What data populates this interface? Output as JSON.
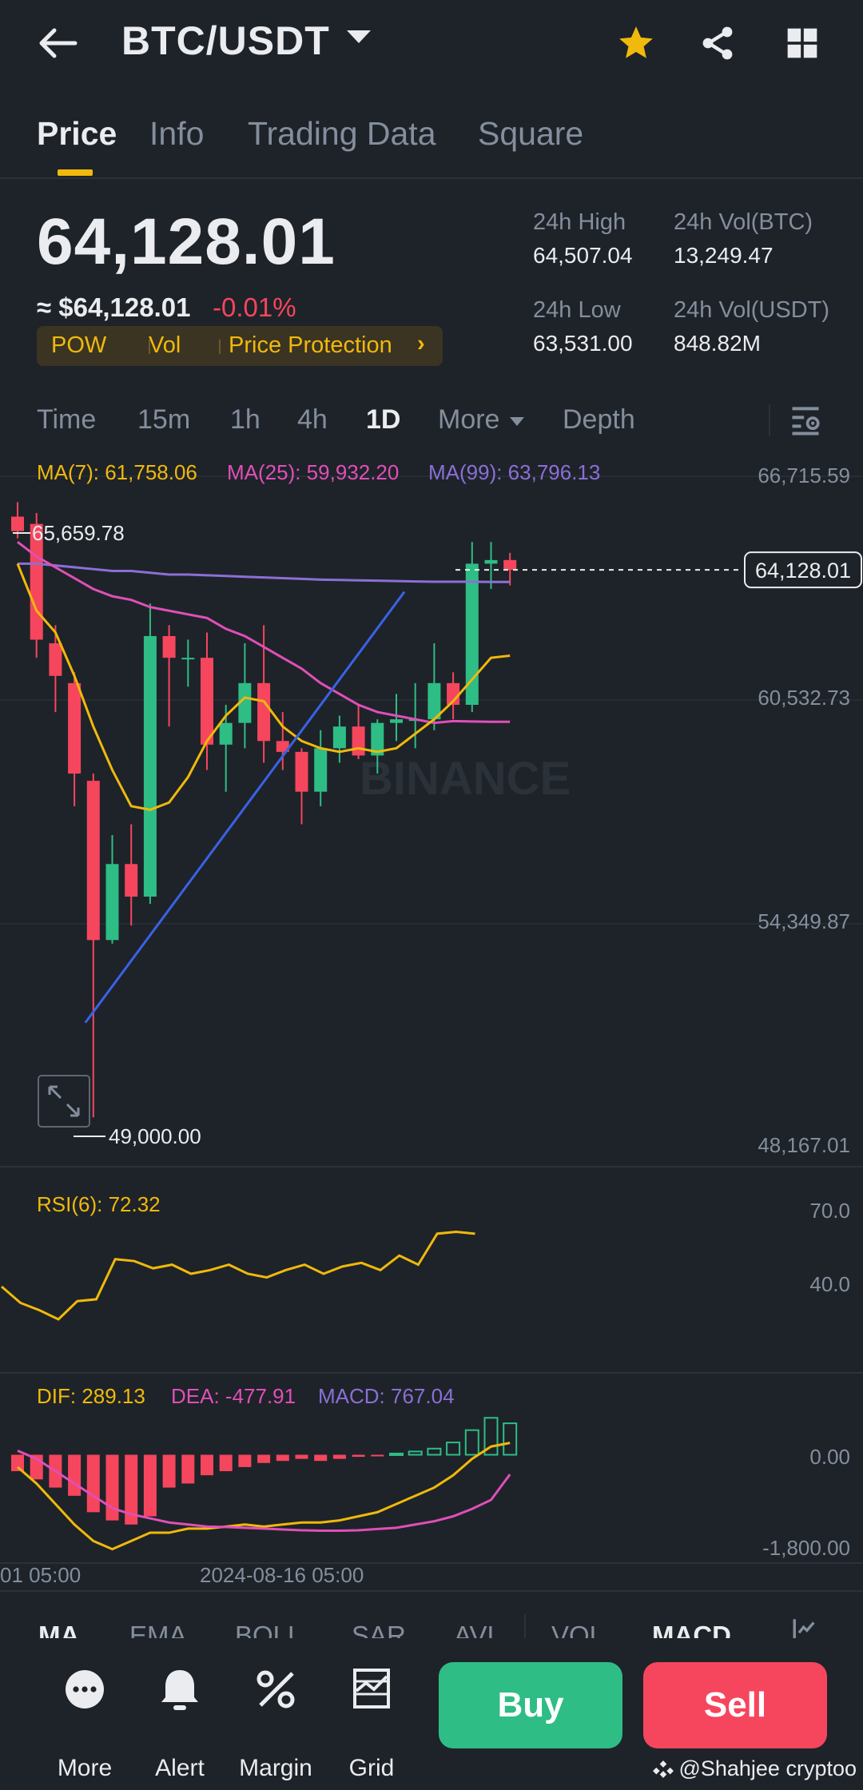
{
  "header": {
    "pair": "BTC/USDT",
    "icons": [
      "back-arrow-icon",
      "star-icon",
      "share-icon",
      "grid-icon"
    ],
    "star_color": "#f0b90b"
  },
  "tabs": [
    {
      "label": "Price",
      "active": true
    },
    {
      "label": "Info",
      "active": false
    },
    {
      "label": "Trading Data",
      "active": false
    },
    {
      "label": "Square",
      "active": false
    }
  ],
  "price": {
    "last": "64,128.01",
    "usd": "≈ $64,128.01",
    "change": "-0.01%",
    "tags": [
      "POW",
      "Vol",
      "Price Protection"
    ]
  },
  "stats": {
    "high_label": "24h High",
    "high_value": "64,507.04",
    "low_label": "24h Low",
    "low_value": "63,531.00",
    "vol_btc_label": "24h Vol(BTC)",
    "vol_btc_value": "13,249.47",
    "vol_usdt_label": "24h Vol(USDT)",
    "vol_usdt_value": "848.82M"
  },
  "intervals": [
    {
      "label": "Time",
      "active": false
    },
    {
      "label": "15m",
      "active": false
    },
    {
      "label": "1h",
      "active": false
    },
    {
      "label": "4h",
      "active": false
    },
    {
      "label": "1D",
      "active": true
    },
    {
      "label": "More",
      "active": false
    },
    {
      "label": "Depth",
      "active": false
    }
  ],
  "chart_data": {
    "type": "candlestick",
    "ma_legend": {
      "ma7": "MA(7): 61,758.06",
      "ma25": "MA(25): 59,932.20",
      "ma99": "MA(99): 63,796.13"
    },
    "y_axis_labels": [
      "66,715.59",
      "60,532.73",
      "54,349.87",
      "48,167.01"
    ],
    "ylim": [
      48167.01,
      66715.59
    ],
    "high_marker": "65,659.78",
    "low_marker": "49,000.00",
    "last_price_tag": "64,128.01",
    "watermark": "BINANCE",
    "candles": [
      {
        "o": 65600,
        "h": 66000,
        "l": 65000,
        "c": 65200
      },
      {
        "o": 65400,
        "h": 65700,
        "l": 61700,
        "c": 62200
      },
      {
        "o": 62100,
        "h": 62600,
        "l": 60200,
        "c": 61200
      },
      {
        "o": 61000,
        "h": 61300,
        "l": 57600,
        "c": 58500
      },
      {
        "o": 58300,
        "h": 58500,
        "l": 49000,
        "c": 53900
      },
      {
        "o": 53900,
        "h": 56800,
        "l": 53800,
        "c": 56000
      },
      {
        "o": 56000,
        "h": 57100,
        "l": 54300,
        "c": 55100
      },
      {
        "o": 55100,
        "h": 63200,
        "l": 54900,
        "c": 62300
      },
      {
        "o": 62300,
        "h": 62600,
        "l": 59800,
        "c": 61700
      },
      {
        "o": 61700,
        "h": 62200,
        "l": 60900,
        "c": 61700
      },
      {
        "o": 61700,
        "h": 62400,
        "l": 58600,
        "c": 59300
      },
      {
        "o": 59300,
        "h": 60400,
        "l": 58000,
        "c": 59900
      },
      {
        "o": 59900,
        "h": 62100,
        "l": 59200,
        "c": 61000
      },
      {
        "o": 61000,
        "h": 62600,
        "l": 58800,
        "c": 59400
      },
      {
        "o": 59400,
        "h": 60200,
        "l": 58600,
        "c": 59100
      },
      {
        "o": 59100,
        "h": 59200,
        "l": 57100,
        "c": 58000
      },
      {
        "o": 58000,
        "h": 59700,
        "l": 57600,
        "c": 59200
      },
      {
        "o": 59200,
        "h": 60100,
        "l": 58800,
        "c": 59800
      },
      {
        "o": 59800,
        "h": 60400,
        "l": 58900,
        "c": 59000
      },
      {
        "o": 59000,
        "h": 60000,
        "l": 58500,
        "c": 59900
      },
      {
        "o": 59900,
        "h": 60700,
        "l": 59400,
        "c": 60000
      },
      {
        "o": 60000,
        "h": 61000,
        "l": 59200,
        "c": 60000
      },
      {
        "o": 60000,
        "h": 62100,
        "l": 59700,
        "c": 61000
      },
      {
        "o": 61000,
        "h": 61300,
        "l": 60000,
        "c": 60400
      },
      {
        "o": 60400,
        "h": 64900,
        "l": 60200,
        "c": 64300
      },
      {
        "o": 64300,
        "h": 64900,
        "l": 63600,
        "c": 64400
      },
      {
        "o": 64400,
        "h": 64600,
        "l": 63700,
        "c": 64128
      }
    ],
    "ma7": [
      64300,
      63000,
      62400,
      61200,
      59800,
      58600,
      57600,
      57500,
      57700,
      58400,
      59400,
      60100,
      60600,
      60500,
      59800,
      59400,
      59200,
      59100,
      59200,
      59100,
      59200,
      59600,
      60000,
      60500,
      61100,
      61700,
      61758
    ],
    "ma25": [
      64900,
      64500,
      64200,
      63900,
      63600,
      63400,
      63300,
      63100,
      63000,
      62900,
      62800,
      62500,
      62300,
      62000,
      61700,
      61400,
      61000,
      60700,
      60400,
      60200,
      60100,
      60000,
      59900,
      59950,
      59940,
      59930,
      59932
    ],
    "ma99": [
      64300,
      64300,
      64250,
      64200,
      64150,
      64100,
      64100,
      64050,
      64000,
      64000,
      63980,
      63960,
      63940,
      63920,
      63900,
      63880,
      63860,
      63850,
      63840,
      63830,
      63820,
      63810,
      63800,
      63800,
      63800,
      63796,
      63796
    ],
    "trendline": [
      {
        "i": 4,
        "v": 52500
      },
      {
        "i": 20,
        "v": 63300
      }
    ],
    "rsi": {
      "legend": "RSI(6): 72.32",
      "y_labels": [
        "70.0",
        "40.0"
      ],
      "ylim": [
        0,
        100
      ],
      "values": [
        43,
        34,
        30,
        25,
        35,
        36,
        58,
        57,
        53,
        55,
        50,
        52,
        55,
        50,
        48,
        52,
        55,
        50,
        54,
        56,
        52,
        60,
        55,
        72,
        73,
        72
      ]
    },
    "macd": {
      "legend_dif": "DIF: 289.13",
      "legend_dea": "DEA: -477.91",
      "legend_macd": "MACD: 767.04",
      "y_labels": [
        "0.00",
        "-1,800.00"
      ],
      "ylim": [
        -2600,
        1100
      ],
      "dif": [
        -300,
        -700,
        -1200,
        -1700,
        -2100,
        -2300,
        -2100,
        -1900,
        -1900,
        -1800,
        -1800,
        -1750,
        -1700,
        -1750,
        -1700,
        -1650,
        -1650,
        -1600,
        -1500,
        -1400,
        -1200,
        -1000,
        -800,
        -500,
        -100,
        200,
        289
      ],
      "dea": [
        100,
        -100,
        -400,
        -700,
        -1000,
        -1300,
        -1450,
        -1550,
        -1650,
        -1700,
        -1750,
        -1760,
        -1780,
        -1800,
        -1820,
        -1840,
        -1850,
        -1850,
        -1840,
        -1810,
        -1780,
        -1700,
        -1620,
        -1500,
        -1320,
        -1100,
        -478
      ],
      "hist": [
        -400,
        -600,
        -800,
        -1000,
        -1400,
        -1600,
        -1700,
        -1500,
        -800,
        -700,
        -500,
        -400,
        -300,
        -200,
        -150,
        -100,
        -150,
        -100,
        -50,
        -30,
        30,
        80,
        150,
        300,
        600,
        900,
        767
      ]
    },
    "x_labels": [
      "01 05:00",
      "2024-08-16 05:00"
    ]
  },
  "indicators": [
    {
      "label": "MA",
      "active": true
    },
    {
      "label": "EMA",
      "active": false
    },
    {
      "label": "BOLL",
      "active": false
    },
    {
      "label": "SAR",
      "active": false
    },
    {
      "label": "AVL",
      "active": false
    },
    {
      "label": "VOL",
      "active": false
    },
    {
      "label": "MACD",
      "active": true
    }
  ],
  "bottom_bar": {
    "more": "More",
    "alert": "Alert",
    "margin": "Margin",
    "grid": "Grid",
    "buy": "Buy",
    "sell": "Sell"
  },
  "credit": "@Shahjee cryptoo",
  "colors": {
    "up": "#2ebd85",
    "down": "#f6465d",
    "ma7": "#f0b90b",
    "ma25": "#e04fb8",
    "ma99": "#8b6fd6",
    "trendline": "#3a62e8",
    "accent": "#f0b90b",
    "background": "#1e2329"
  }
}
